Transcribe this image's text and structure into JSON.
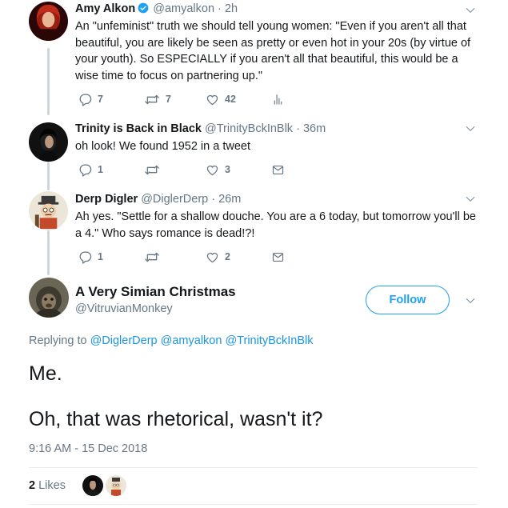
{
  "tweets": [
    {
      "name": "Amy Alkon",
      "handle": "@amyalkon",
      "time": "· 2h",
      "verified": true,
      "text": "An \"unfeminist\" truth we should tell young women: \"Even if you aren't all that beautiful, you are likely be seen as pretty or even hot in your 20s (by virtue of your youth). So ESPECIALLY if you aren't all that beautiful, this would be a wise time to focus on partnering up.\"",
      "replies": "7",
      "retweets": "7",
      "likes": "42"
    },
    {
      "name": "Trinity is Back in Black",
      "handle": "@TrinityBckInBlk",
      "time": "· 36m",
      "text": "oh look! We found 1952 in a tweet",
      "replies": "1",
      "retweets": "",
      "likes": "3"
    },
    {
      "name": "Derp Digler",
      "handle": "@DiglerDerp",
      "time": "· 26m",
      "text": "Ah yes. \"Settle for a shallow douche. You are a 6 today, but tomorrow you'll be a 4.\" Who says romance is dead!?!",
      "replies": "1",
      "retweets": "",
      "likes": "2"
    }
  ],
  "focus": {
    "name": "A Very Simian Christmas",
    "handle": "@VitruvianMonkey",
    "follow_label": "Follow",
    "replying_prefix": "Replying to",
    "replying_to": [
      "@DiglerDerp",
      "@amyalkon",
      "@TrinityBckInBlk"
    ],
    "text_line1": "Me.",
    "text_line2": "Oh, that was rhetorical, wasn't it?",
    "timestamp": "9:16 AM - 15 Dec 2018",
    "likes_count": "2",
    "likes_label": "Likes"
  },
  "colors": {
    "accent": "#1da1f2",
    "link": "#1b95e0",
    "muted": "#657786",
    "thread_line": "#ccd6dd"
  },
  "icons": [
    "reply-icon",
    "retweet-icon",
    "like-icon",
    "analytics-icon",
    "direct-message-icon",
    "chevron-down-icon",
    "verified-badge-icon"
  ]
}
